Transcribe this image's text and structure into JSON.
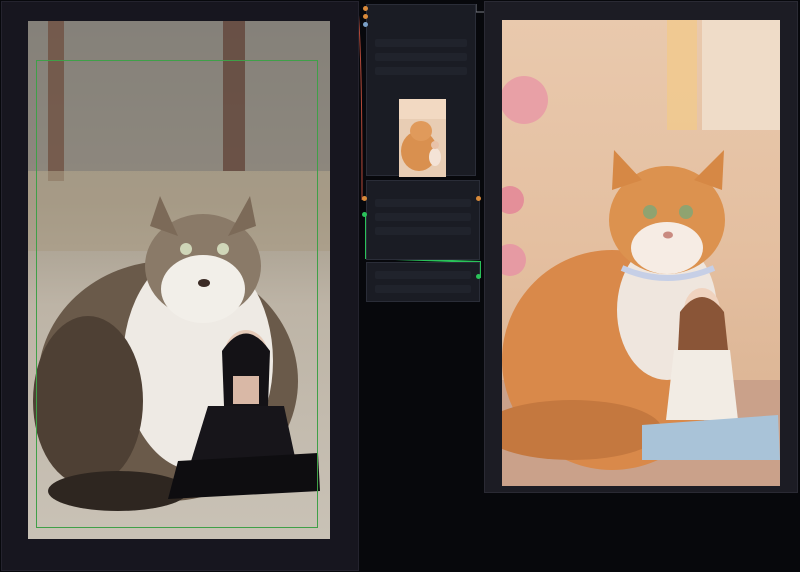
{
  "nodes": {
    "preview_label": "",
    "bottom_label": "",
    "mid_label": ""
  },
  "colors": {
    "accent_wire": "#2ac25a",
    "node_bg": "#17161f",
    "crop_outline": "#3fa048"
  },
  "icons": [
    "socket-icon"
  ]
}
